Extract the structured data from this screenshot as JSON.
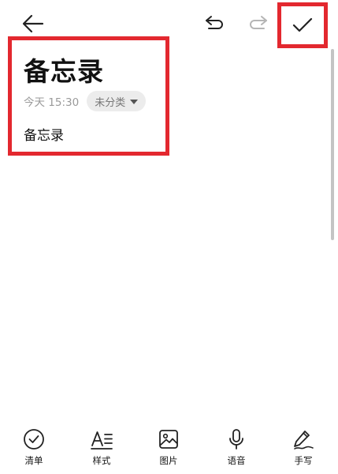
{
  "header": {
    "back_icon": "arrow-left-icon",
    "undo_icon": "undo-icon",
    "redo_icon": "redo-icon",
    "confirm_icon": "checkmark-icon"
  },
  "note": {
    "title": "备忘录",
    "time": "今天 15:30",
    "category": "未分类",
    "body": "备忘录"
  },
  "toolbar": {
    "items": [
      {
        "label": "清单",
        "icon": "checklist-icon"
      },
      {
        "label": "样式",
        "icon": "text-style-icon"
      },
      {
        "label": "图片",
        "icon": "image-icon"
      },
      {
        "label": "语音",
        "icon": "microphone-icon"
      },
      {
        "label": "手写",
        "icon": "pen-icon"
      }
    ]
  },
  "colors": {
    "highlight": "#e3282f",
    "muted_text": "#9a9a9a",
    "chip_bg": "#ececec",
    "redo_disabled": "#b5b5b5"
  }
}
